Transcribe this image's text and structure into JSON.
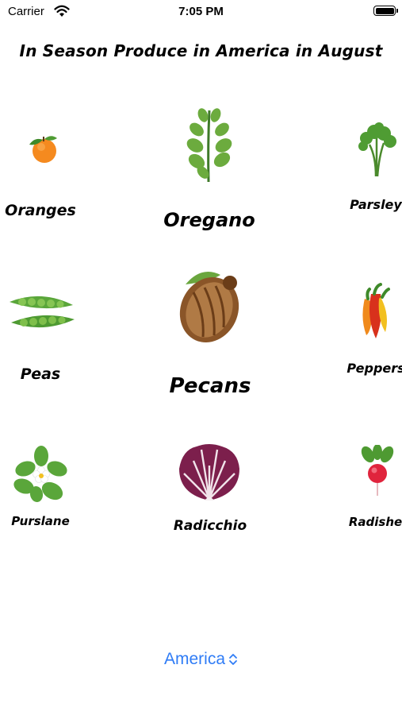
{
  "status_bar": {
    "carrier": "Carrier",
    "time": "7:05 PM"
  },
  "title": "In Season Produce in America in August",
  "items": [
    {
      "name": "Oranges",
      "icon": "orange-icon"
    },
    {
      "name": "Oregano",
      "icon": "oregano-icon"
    },
    {
      "name": "Parsley",
      "icon": "parsley-icon"
    },
    {
      "name": "Peas",
      "icon": "peas-icon"
    },
    {
      "name": "Pecans",
      "icon": "pecan-icon"
    },
    {
      "name": "Peppers",
      "icon": "peppers-icon"
    },
    {
      "name": "Purslane",
      "icon": "purslane-icon"
    },
    {
      "name": "Radicchio",
      "icon": "radicchio-icon"
    },
    {
      "name": "Radishes",
      "icon": "radish-icon"
    }
  ],
  "region_picker": {
    "value": "America",
    "accent_color": "#2f7cf6"
  }
}
